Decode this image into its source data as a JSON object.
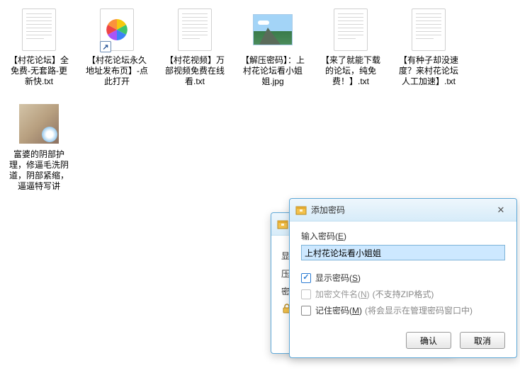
{
  "files": [
    {
      "type": "txt",
      "label": "【村花论坛】全免费-无套路-更新快.txt"
    },
    {
      "type": "shortcut",
      "label": "【村花论坛永久地址发布页】-点此打开"
    },
    {
      "type": "txt",
      "label": "【村花视频】万部视频免费在线看.txt"
    },
    {
      "type": "jpg",
      "label": "【解压密码】：上村花论坛看小姐姐.jpg"
    },
    {
      "type": "txt",
      "label": "【来了就能下载的论坛，纯免费！】.txt"
    },
    {
      "type": "txt",
      "label": "【有种子却没速度？来村花论坛人工加速】.txt"
    },
    {
      "type": "thumb",
      "label": "富婆的阴部护理，修逼毛洗阴道，阴部紧缩，逼逼特写讲解，..."
    }
  ],
  "dialog_front": {
    "title": "添加密码",
    "input_label_pre": "输入密码(",
    "input_label_key": "E",
    "input_label_post": ")",
    "password_value": "上村花论坛看小姐姐",
    "check1_pre": "显示密码(",
    "check1_key": "S",
    "check1_post": ")",
    "check1_checked": true,
    "check2_pre": "加密文件名(",
    "check2_key": "N",
    "check2_post": ")",
    "check2_hint": "(不支持ZIP格式)",
    "check3_pre": "记住密码(",
    "check3_key": "M",
    "check3_post": ")",
    "check3_hint": "(将会显示在管理密码窗口中)",
    "ok": "确认",
    "cancel": "取消"
  },
  "dialog_back": {
    "row1": "显",
    "row2": "压",
    "row3": "密"
  }
}
